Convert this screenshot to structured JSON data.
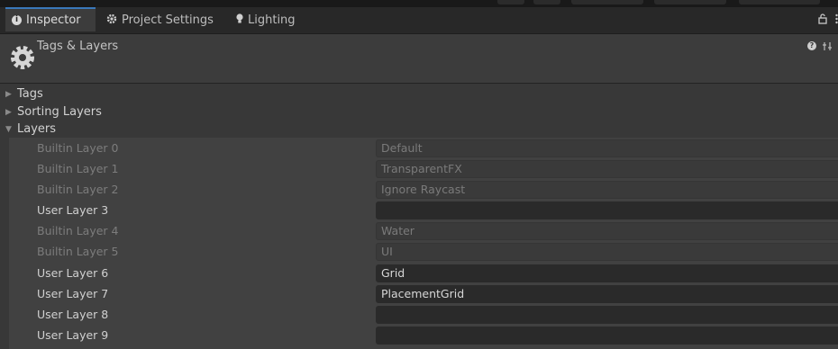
{
  "tabs": [
    {
      "label": "Inspector",
      "icon": "info-icon",
      "active": true
    },
    {
      "label": "Project Settings",
      "icon": "gear-icon",
      "active": false
    },
    {
      "label": "Lighting",
      "icon": "lightbulb-icon",
      "active": false
    }
  ],
  "header": {
    "title": "Tags & Layers",
    "icon": "gear-icon"
  },
  "sections": {
    "tags": {
      "label": "Tags",
      "expanded": false
    },
    "sorting_layers": {
      "label": "Sorting Layers",
      "expanded": false
    },
    "layers": {
      "label": "Layers",
      "expanded": true
    }
  },
  "layers": [
    {
      "label": "Builtin Layer 0",
      "value": "Default",
      "builtin": true
    },
    {
      "label": "Builtin Layer 1",
      "value": "TransparentFX",
      "builtin": true
    },
    {
      "label": "Builtin Layer 2",
      "value": "Ignore Raycast",
      "builtin": true
    },
    {
      "label": "User Layer 3",
      "value": "",
      "builtin": false
    },
    {
      "label": "Builtin Layer 4",
      "value": "Water",
      "builtin": true
    },
    {
      "label": "Builtin Layer 5",
      "value": "UI",
      "builtin": true
    },
    {
      "label": "User Layer 6",
      "value": "Grid",
      "builtin": false
    },
    {
      "label": "User Layer 7",
      "value": "PlacementGrid",
      "builtin": false
    },
    {
      "label": "User Layer 8",
      "value": "",
      "builtin": false
    },
    {
      "label": "User Layer 9",
      "value": "",
      "builtin": false
    }
  ],
  "colors": {
    "accent": "#3a79bb",
    "background": "#383838",
    "field": "#2a2a2a"
  }
}
